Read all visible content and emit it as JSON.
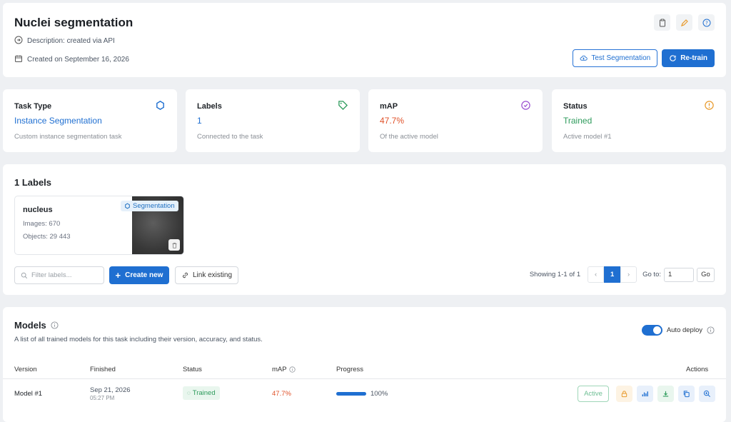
{
  "header": {
    "title": "Nuclei segmentation",
    "description": "Description: created via API",
    "created": "Created on September 16, 2026",
    "test_button": "Test Segmentation",
    "retrain_button": "Re-train"
  },
  "stats": [
    {
      "label": "Task Type",
      "value": "Instance Segmentation",
      "sub": "Custom instance segmentation task",
      "color": "#1f6fd1",
      "icon": "hexagon-icon"
    },
    {
      "label": "Labels",
      "value": "1",
      "sub": "Connected to the task",
      "color": "#1f6fd1",
      "icon": "tag-icon"
    },
    {
      "label": "mAP",
      "value": "47.7%",
      "sub": "Of the active model",
      "color": "#e0522a",
      "icon": "check-circle-icon"
    },
    {
      "label": "Status",
      "value": "Trained",
      "sub": "Active model #1",
      "color": "#2e9b5c",
      "icon": "alert-circle-icon"
    }
  ],
  "labels_section": {
    "title": "1 Labels",
    "card": {
      "name": "nucleus",
      "images": "Images: 670",
      "objects": "Objects: 29 443",
      "badge": "Segmentation"
    },
    "filter_placeholder": "Filter labels...",
    "create_button": "Create new",
    "link_button": "Link existing",
    "showing": "Showing 1-1 of 1",
    "current_page": "1",
    "goto_label": "Go to:",
    "goto_value": "1",
    "go_button": "Go"
  },
  "models_section": {
    "title": "Models",
    "subtitle": "A list of all trained models for this task including their version, accuracy, and status.",
    "auto_deploy": "Auto deploy",
    "columns": {
      "version": "Version",
      "finished": "Finished",
      "status": "Status",
      "map": "mAP",
      "progress": "Progress",
      "actions": "Actions"
    },
    "row": {
      "version": "Model #1",
      "date": "Sep 21, 2026",
      "time": "05:27 PM",
      "status": "Trained",
      "map": "47.7%",
      "progress": "100%",
      "active": "Active"
    }
  },
  "colors": {
    "accent": "#1f6fd1",
    "success": "#2e9b5c",
    "warning": "#e0522a",
    "amber": "#e89a2c"
  }
}
